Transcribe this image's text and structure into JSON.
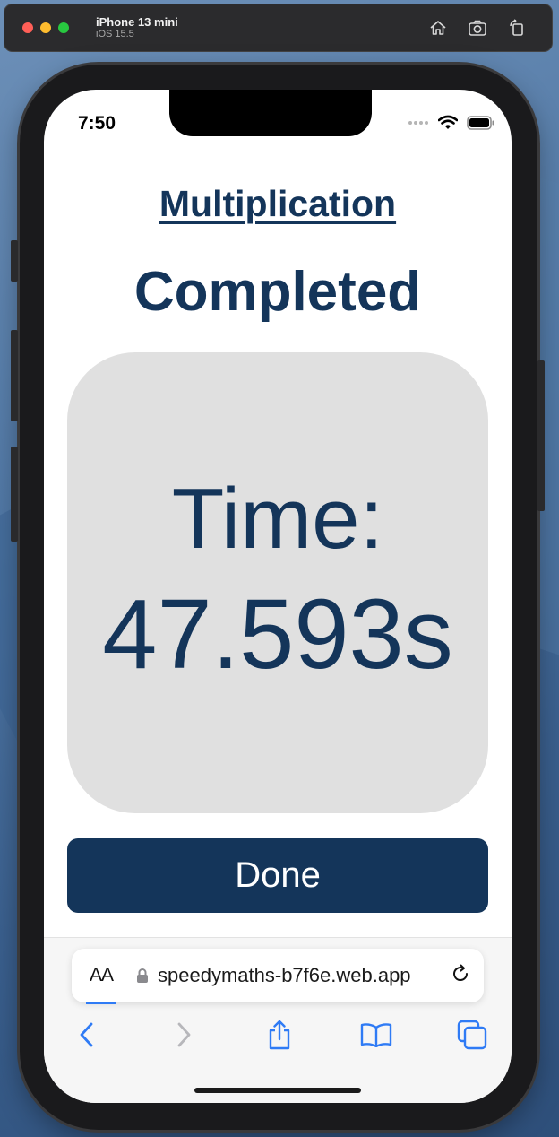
{
  "simulator": {
    "device_name": "iPhone 13 mini",
    "os_version": "iOS 15.5",
    "tools": [
      "home-icon",
      "screenshot-icon",
      "rotate-icon"
    ]
  },
  "status_bar": {
    "time": "7:50"
  },
  "app": {
    "title": "Multiplication",
    "heading": "Completed",
    "time_label": "Time:",
    "time_value": "47.593s",
    "done_label": "Done",
    "colors": {
      "primary": "#14355a",
      "card_bg": "#e0e0e0"
    }
  },
  "safari": {
    "text_size_label": "AA",
    "url": "speedymaths-b7f6e.web.app",
    "accent": "#2f7bf5"
  }
}
